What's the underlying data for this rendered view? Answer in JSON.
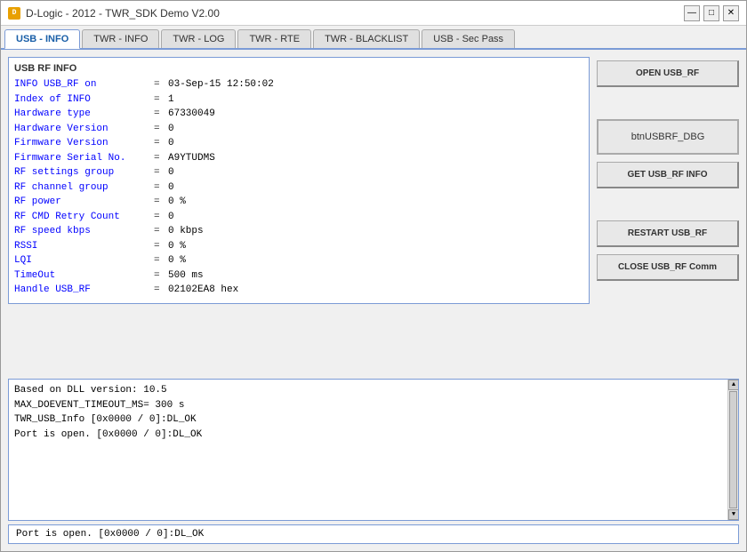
{
  "window": {
    "title": "D-Logic - 2012 - TWR_SDK Demo V2.00",
    "icon": "D",
    "controls": {
      "minimize": "—",
      "maximize": "□",
      "close": "✕"
    }
  },
  "tabs": [
    {
      "label": "USB - INFO",
      "active": true
    },
    {
      "label": "TWR - INFO",
      "active": false
    },
    {
      "label": "TWR - LOG",
      "active": false
    },
    {
      "label": "TWR - RTE",
      "active": false
    },
    {
      "label": "TWR - BLACKLIST",
      "active": false
    },
    {
      "label": "USB - Sec Pass",
      "active": false
    }
  ],
  "rf_info": {
    "title": "USB RF INFO",
    "rows": [
      {
        "label": "INFO USB_RF on",
        "eq": "=",
        "value": "03-Sep-15  12:50:02"
      },
      {
        "label": "Index of INFO",
        "eq": "=",
        "value": "1"
      },
      {
        "label": "Hardware type",
        "eq": "=",
        "value": "67330049"
      },
      {
        "label": "Hardware Version",
        "eq": "=",
        "value": "0"
      },
      {
        "label": "Firmware Version",
        "eq": "=",
        "value": "0"
      },
      {
        "label": "Firmware Serial No.",
        "eq": "=",
        "value": "A9YTUDMS"
      },
      {
        "label": "RF settings group",
        "eq": "=",
        "value": "0"
      },
      {
        "label": "RF channel group",
        "eq": "=",
        "value": "0"
      },
      {
        "label": "RF power",
        "eq": "=",
        "value": "0 %"
      },
      {
        "label": "RF CMD Retry Count",
        "eq": "=",
        "value": "0"
      },
      {
        "label": "RF speed kbps",
        "eq": "=",
        "value": "0 kbps"
      },
      {
        "label": "RSSI",
        "eq": "=",
        "value": "0 %"
      },
      {
        "label": "LQI",
        "eq": "=",
        "value": "0 %"
      },
      {
        "label": "TimeOut",
        "eq": "=",
        "value": "500 ms"
      },
      {
        "label": "Handle USB_RF",
        "eq": "=",
        "value": "02102EA8 hex"
      }
    ]
  },
  "buttons": {
    "open_usb_rf": "OPEN USB_RF",
    "debug": "btnUSBRF_DBG",
    "get_info": "GET USB_RF INFO",
    "restart": "RESTART USB_RF",
    "close_comm": "CLOSE USB_RF Comm"
  },
  "log": {
    "lines": [
      "Based on DLL version: 10.5",
      "MAX_DOEVENT_TIMEOUT_MS= 300 s",
      "TWR_USB_Info [0x0000 / 0]:DL_OK",
      "Port is open. [0x0000 / 0]:DL_OK"
    ]
  },
  "status_bar": {
    "text": "Port is open. [0x0000 / 0]:DL_OK"
  }
}
